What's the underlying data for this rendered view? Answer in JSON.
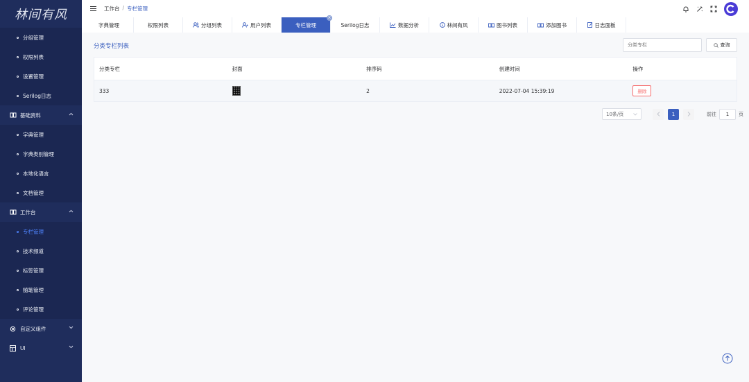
{
  "logo": "林间有风",
  "sidebar": {
    "items": [
      {
        "label": "分组管理",
        "type": "sub"
      },
      {
        "label": "权限列表",
        "type": "sub"
      },
      {
        "label": "设置管理",
        "type": "sub"
      },
      {
        "label": "Serilog日志",
        "type": "sub"
      },
      {
        "label": "基础资料",
        "type": "group"
      },
      {
        "label": "字典管理",
        "type": "sub"
      },
      {
        "label": "字典类别管理",
        "type": "sub"
      },
      {
        "label": "本地化语言",
        "type": "sub"
      },
      {
        "label": "文档管理",
        "type": "sub"
      },
      {
        "label": "工作台",
        "type": "group"
      },
      {
        "label": "专栏管理",
        "type": "sub",
        "active": true
      },
      {
        "label": "技术频道",
        "type": "sub"
      },
      {
        "label": "标签管理",
        "type": "sub"
      },
      {
        "label": "随笔管理",
        "type": "sub"
      },
      {
        "label": "评论管理",
        "type": "sub"
      },
      {
        "label": "自定义组件",
        "type": "group"
      },
      {
        "label": "UI",
        "type": "group"
      }
    ]
  },
  "breadcrumb": {
    "root": "工作台",
    "sep": "/",
    "current": "专栏管理"
  },
  "tabs": [
    {
      "label": "字典管理",
      "icon": ""
    },
    {
      "label": "权限列表",
      "icon": ""
    },
    {
      "label": "分组列表",
      "icon": "user-group-icon"
    },
    {
      "label": "用户列表",
      "icon": "user-icon"
    },
    {
      "label": "专栏管理",
      "icon": "",
      "active": true
    },
    {
      "label": "Serilog日志",
      "icon": ""
    },
    {
      "label": "数据分析",
      "icon": "chart-icon"
    },
    {
      "label": "林间有风",
      "icon": "info-icon"
    },
    {
      "label": "图书列表",
      "icon": "book-icon"
    },
    {
      "label": "添加图书",
      "icon": "book-icon"
    },
    {
      "label": "日志面板",
      "icon": "edit-icon"
    }
  ],
  "panel": {
    "title": "分类专栏列表"
  },
  "search": {
    "placeholder": "分类专栏",
    "button": "查询"
  },
  "table": {
    "headers": [
      "分类专栏",
      "封面",
      "排序码",
      "创建时间",
      "操作"
    ],
    "rows": [
      {
        "name": "333",
        "sort": "2",
        "created": "2022-07-04 15:39:19",
        "action": "删除"
      }
    ]
  },
  "pagination": {
    "page_size": "10条/页",
    "current_page": "1",
    "goto_label": "前往",
    "goto_value": "1",
    "page_suffix": "页"
  },
  "colors": {
    "sidebar": "#1f2d5c",
    "accent": "#3b5fbf",
    "danger": "#f56c6c"
  }
}
